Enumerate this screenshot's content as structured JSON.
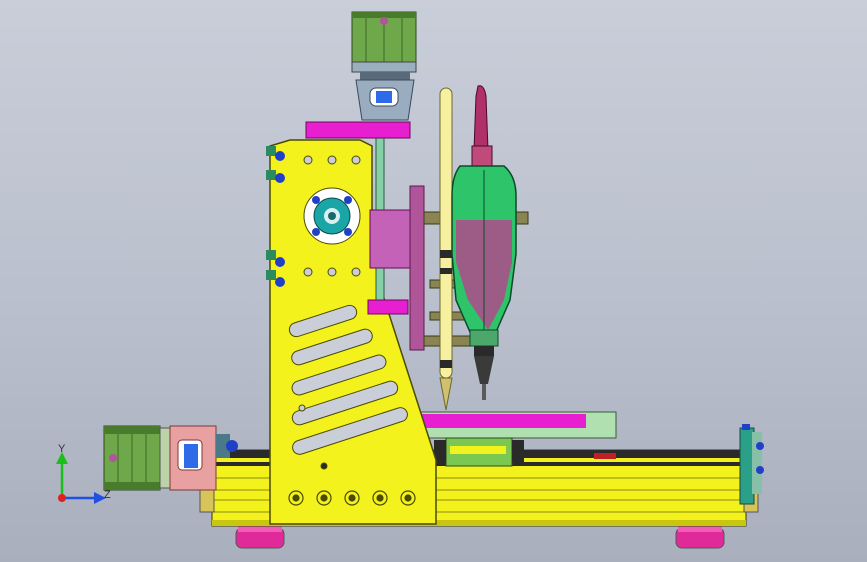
{
  "viewport": {
    "background_top": "#c9ced9",
    "background_bottom": "#a9afbd"
  },
  "colors": {
    "frame_yellow": "#f4f21c",
    "carriage_magenta": "#e81fd0",
    "plate_mauve": "#b0559a",
    "motor_green": "#6ea84a",
    "spindle_green": "#2ec46a",
    "rail_dark": "#2a2a2a",
    "foot_pink": "#e02a9a",
    "blue_bolt": "#2040c8",
    "teal_hub": "#1aa6a6",
    "axis_y": "#18c018",
    "axis_z": "#2050e0",
    "axis_x": "#e02020"
  },
  "triad": {
    "y_label": "Y",
    "z_label": "Z"
  }
}
